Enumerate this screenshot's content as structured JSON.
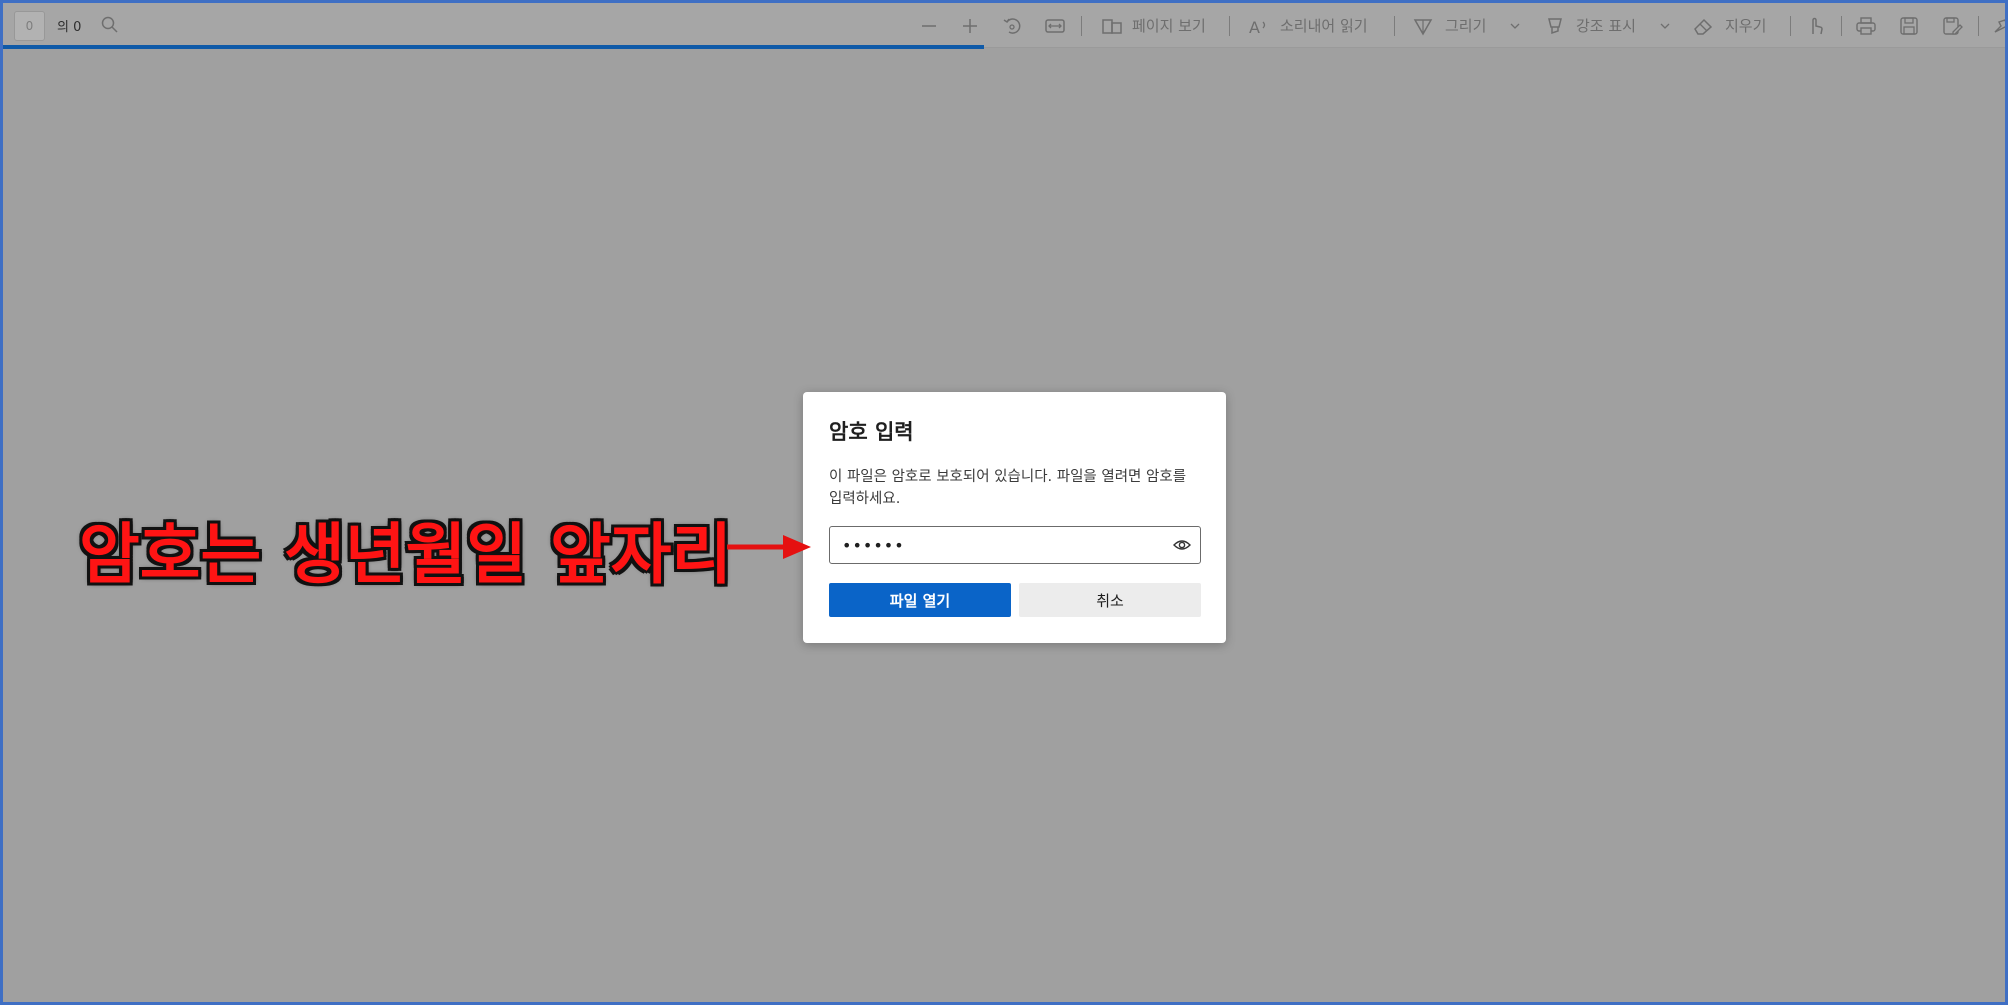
{
  "toolbar": {
    "page_number": "0",
    "page_total": "의 0",
    "page_view_label": "페이지 보기",
    "read_aloud_label": "소리내어 읽기",
    "draw_label": "그리기",
    "highlight_label": "강조 표시",
    "erase_label": "지우기"
  },
  "progress": {
    "fraction": 0.49,
    "color": "#0f5aa8"
  },
  "dialog": {
    "title": "암호 입력",
    "message": "이 파일은 암호로 보호되어 있습니다. 파일을 열려면 암호를 입력하세요.",
    "password_value": "••••••",
    "open_button": "파일 열기",
    "cancel_button": "취소",
    "accent_color": "#0a64c8"
  },
  "annotation": {
    "text": "암호는 생년월일 앞자리",
    "color": "#ff1414"
  }
}
